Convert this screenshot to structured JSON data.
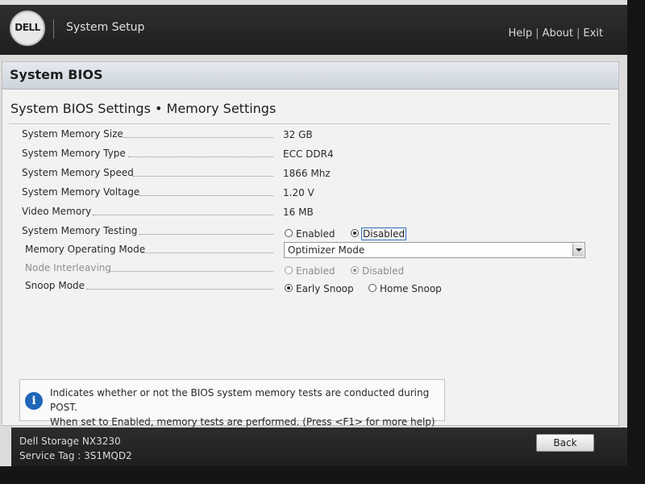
{
  "header": {
    "logo_text": "DELL",
    "title": "System Setup",
    "links": [
      "Help",
      "About",
      "Exit"
    ],
    "separator": "|"
  },
  "panel": {
    "title": "System BIOS",
    "subtitle": "System BIOS Settings • Memory Settings"
  },
  "settings": {
    "memory_size": {
      "label": "System Memory Size",
      "value": "32 GB"
    },
    "memory_type": {
      "label": "System Memory Type",
      "value": "ECC DDR4"
    },
    "memory_speed": {
      "label": "System Memory Speed",
      "value": "1866 Mhz"
    },
    "memory_voltage": {
      "label": "System Memory Voltage",
      "value": "1.20 V"
    },
    "video_memory": {
      "label": "Video Memory",
      "value": "16 MB"
    },
    "memory_testing": {
      "label": "System Memory Testing",
      "options": [
        "Enabled",
        "Disabled"
      ],
      "selected": "Disabled"
    },
    "operating_mode": {
      "label": "Memory Operating Mode",
      "value": "Optimizer Mode"
    },
    "node_interleaving": {
      "label": "Node Interleaving",
      "options": [
        "Enabled",
        "Disabled"
      ],
      "selected": "Disabled",
      "disabled": true
    },
    "snoop_mode": {
      "label": "Snoop Mode",
      "options": [
        "Early Snoop",
        "Home Snoop"
      ],
      "selected": "Early Snoop"
    }
  },
  "info": {
    "icon": "info-icon",
    "line1": "Indicates whether or not the BIOS system memory tests are conducted during POST.",
    "line2": "When set to Enabled, memory tests are performed. (Press <F1> for more help)"
  },
  "footer": {
    "model": "Dell Storage NX3230",
    "service_tag": "Service Tag : 3S1MQD2",
    "back_label": "Back"
  },
  "colors": {
    "header_bg": "#262626",
    "panel_bg": "#f2f2f2",
    "title_bar": "#d6dbe2",
    "info_icon": "#1f66b8"
  }
}
